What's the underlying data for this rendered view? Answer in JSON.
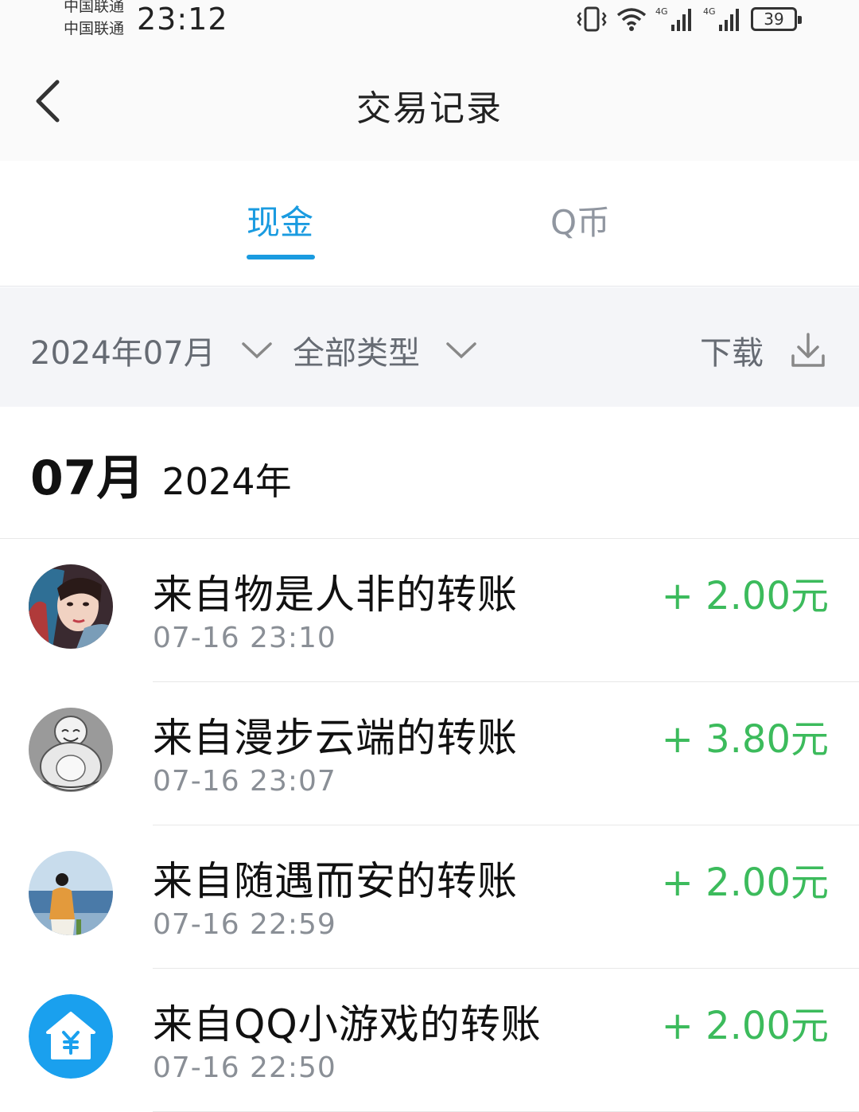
{
  "status_bar": {
    "carrier_1": "中国联通",
    "carrier_2": "中国联通",
    "time": "23:12",
    "network_1": "4G",
    "network_2": "4G",
    "battery": "39"
  },
  "header": {
    "title": "交易记录"
  },
  "tabs": [
    {
      "label": "现金",
      "active": true
    },
    {
      "label": "Q币",
      "active": false
    }
  ],
  "filters": {
    "month": "2024年07月",
    "type": "全部类型",
    "download": "下载"
  },
  "month_section": {
    "month": "07月",
    "year": "2024年"
  },
  "colors": {
    "accent": "#1a9be0",
    "income": "#3cbb5c",
    "secondary_text": "#8a8f96",
    "filter_bg": "#f4f5f8"
  },
  "transactions": [
    {
      "title": "来自物是人非的转账",
      "time": "07-16 23:10",
      "amount": "+ 2.00元",
      "avatar": "woman-headscarf-photo"
    },
    {
      "title": "来自漫步云端的转账",
      "time": "07-16 23:07",
      "amount": "+ 3.80元",
      "avatar": "laughing-buddha-sketch"
    },
    {
      "title": "来自随遇而安的转账",
      "time": "07-16 22:59",
      "amount": "+ 2.00元",
      "avatar": "girl-at-seaside-photo"
    },
    {
      "title": "来自QQ小游戏的转账",
      "time": "07-16 22:50",
      "amount": "+ 2.00元",
      "avatar": "yuan-house-icon"
    }
  ]
}
